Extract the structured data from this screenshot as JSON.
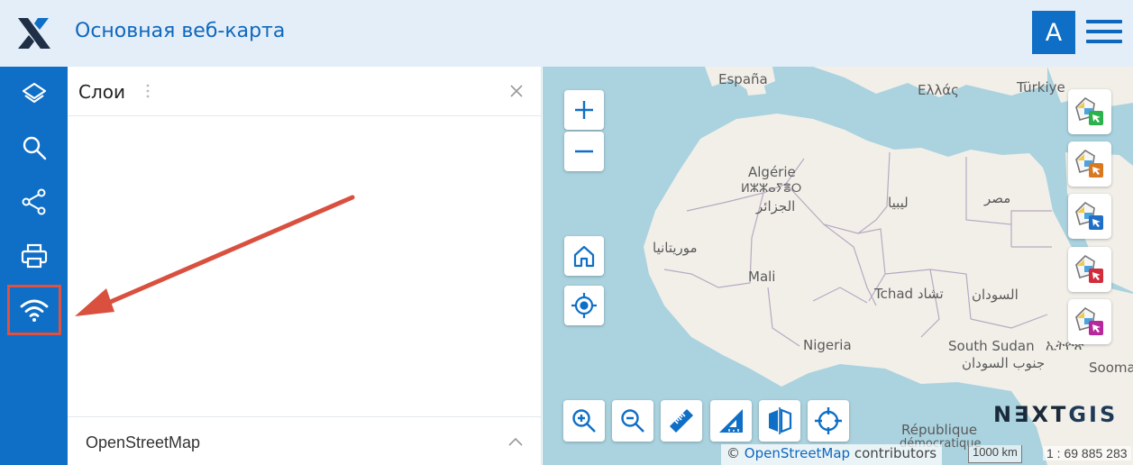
{
  "header": {
    "title": "Основная веб-карта",
    "avatar_letter": "A",
    "logo": "x-logo",
    "menu_icon": "hamburger-icon"
  },
  "sidebar": {
    "items": [
      {
        "icon": "layers-icon"
      },
      {
        "icon": "search-icon"
      },
      {
        "icon": "share-icon"
      },
      {
        "icon": "print-icon"
      },
      {
        "icon": "wifi-icon",
        "highlighted": true
      }
    ]
  },
  "panel": {
    "title": "Слои",
    "footer_label": "OpenStreetMap"
  },
  "map": {
    "labels": {
      "espana": "España",
      "ellas": "Ελλάς",
      "turkiye": "Türkiye",
      "algerie": "Algérie",
      "algerie_tif": "ⵍⵣⵣⴰⵢⴻⵔ",
      "algerie_ar": "الجزائر",
      "libya": "ليبيا",
      "egypt": "مصر",
      "mauritania": "موريتانيا",
      "mali": "Mali",
      "tchad": "Tchad تشاد",
      "sudan": "السودان",
      "nigeria": "Nigeria",
      "south_sudan": "South Sudan",
      "south_sudan_ar": "جنوب السودان",
      "ethiopia": "ኢትዮጵ",
      "somalia": "Sooma",
      "republique": "République",
      "democratique": "démocratique"
    },
    "brand": {
      "part1": "N∃XT",
      "part2": "GIS"
    },
    "attribution": {
      "prefix": "©",
      "link": "OpenStreetMap",
      "suffix": "contributors"
    },
    "scale_bar": "1000 km",
    "scale_ratio": "1 : 69 885 283"
  },
  "colors": {
    "accent": "#0f6fc6",
    "header_bg": "#e3eef8",
    "highlight": "#e3503d",
    "sea": "#aad3df",
    "land": "#f2efe9"
  }
}
